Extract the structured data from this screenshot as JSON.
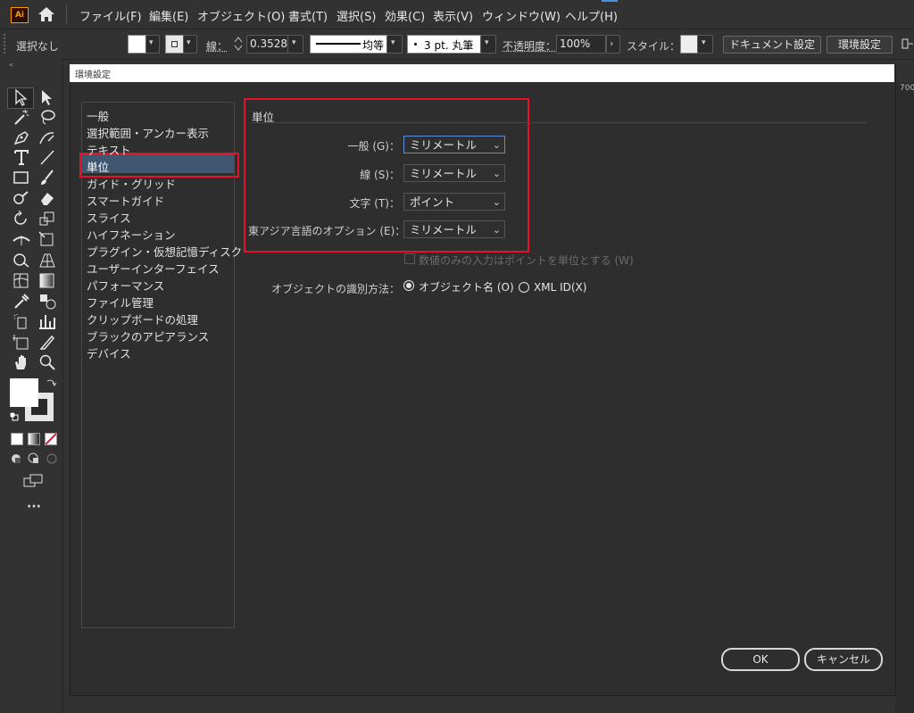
{
  "menubar": {
    "logo": "Ai",
    "items": [
      "ファイル(F)",
      "編集(E)",
      "オブジェクト(O)",
      "書式(T)",
      "選択(S)",
      "効果(C)",
      "表示(V)",
      "ウィンドウ(W)",
      "ヘルプ(H)"
    ]
  },
  "controlbar": {
    "selection_status": "選択なし",
    "stroke_label": "線：",
    "stroke_value": "0.3528",
    "stroke_profile": "均等",
    "brush": "3 pt. 丸筆",
    "opacity_label": "不透明度：",
    "opacity_value": "100%",
    "style_label": "スタイル：",
    "document_setup": "ドキュメント設定",
    "preferences": "環境設定",
    "ruler_number": "700"
  },
  "dialog": {
    "title": "環境設定",
    "categories": [
      "一般",
      "選択範囲・アンカー表示",
      "テキスト",
      "単位",
      "ガイド・グリッド",
      "スマートガイド",
      "スライス",
      "ハイフネーション",
      "プラグイン・仮想記憶ディスク",
      "ユーザーインターフェイス",
      "パフォーマンス",
      "ファイル管理",
      "クリップボードの処理",
      "ブラックのアピアランス",
      "デバイス"
    ],
    "selected_category": "単位",
    "section_title": "単位",
    "fields": {
      "general_label": "一般 (G)：",
      "general_value": "ミリメートル",
      "stroke_label": "線 (S)：",
      "stroke_value": "ミリメートル",
      "type_label": "文字 (T)：",
      "type_value": "ポイント",
      "asian_label": "東アジア言語のオプション (E)：",
      "asian_value": "ミリメートル"
    },
    "numbers_only_checkbox": "数値のみの入力はポイントを単位とする (W)",
    "identify_label": "オブジェクトの識別方法：",
    "identify_option_name": "オブジェクト名 (O)",
    "identify_option_xml": "XML ID(X)",
    "ok": "OK",
    "cancel": "キャンセル"
  },
  "colors": {
    "highlight_red": "#e3132a",
    "selection_blue": "#3f5771",
    "logo_orange": "#ff9a00"
  }
}
